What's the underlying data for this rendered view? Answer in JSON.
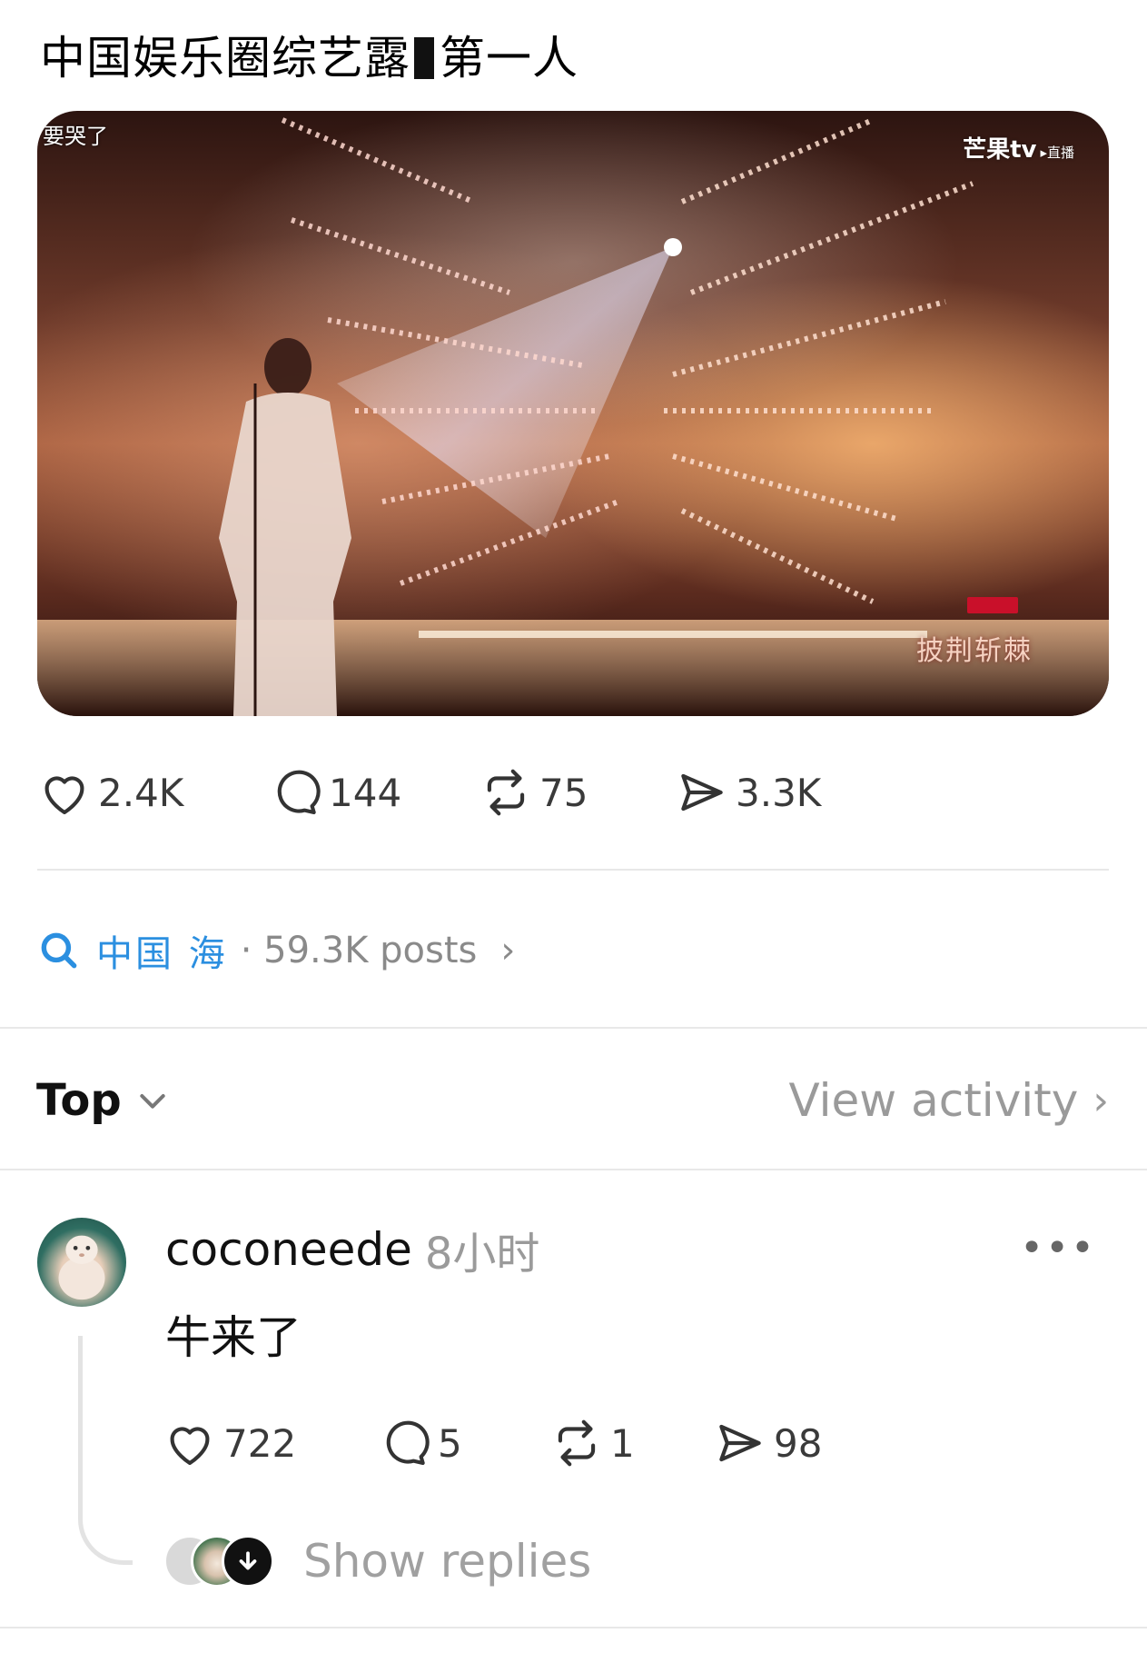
{
  "post": {
    "title_part1": "中国娱乐圈综艺露",
    "title_part2": "第一人",
    "media": {
      "caption": "要哭了",
      "watermark": "芒果tv",
      "watermark_tag": "▸直播",
      "show_logo_text": "披荆斩棘"
    },
    "stats": {
      "likes": "2.4K",
      "comments": "144",
      "reposts": "75",
      "shares": "3.3K"
    }
  },
  "topic": {
    "name": "中国 海",
    "meta": "· 59.3K posts"
  },
  "sort": {
    "label": "Top",
    "view_activity_label": "View activity"
  },
  "reply": {
    "username": "coconeede",
    "time": "8小时",
    "text": "牛来了",
    "stats": {
      "likes": "722",
      "comments": "5",
      "reposts": "1",
      "shares": "98"
    },
    "show_replies_label": "Show replies"
  },
  "icons": {
    "like": "heart-icon",
    "comment": "comment-bubble-icon",
    "repost": "repost-icon",
    "share": "share-send-icon",
    "search": "search-icon",
    "more": "more-dots-icon"
  },
  "colors": {
    "topic_blue": "#2b8fe0",
    "muted_gray": "#9a9a9a"
  }
}
